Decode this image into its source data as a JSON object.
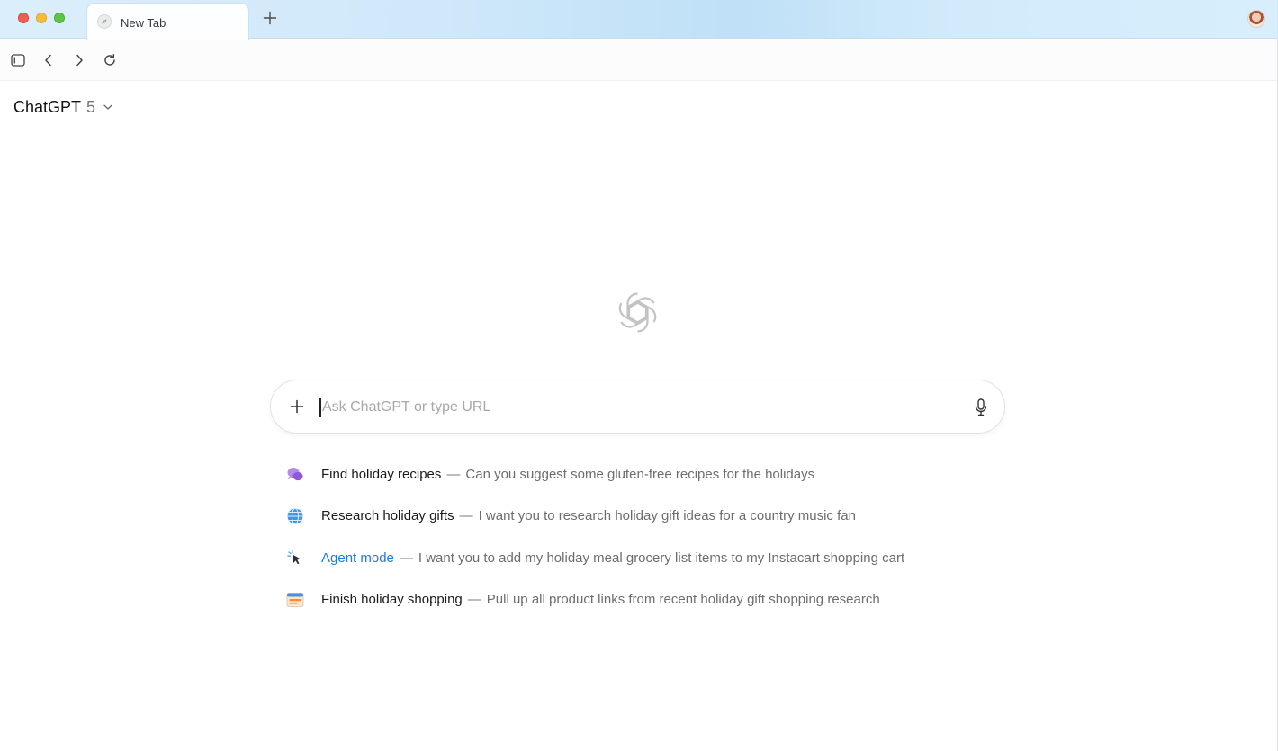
{
  "browser": {
    "tab": {
      "title": "New Tab",
      "icon": "compass-icon"
    },
    "new_tab_icon": "plus-icon",
    "profile_icon": "avatar"
  },
  "toolbar": {
    "sidebar_icon": "sidebar-toggle-icon",
    "back_icon": "chevron-left-icon",
    "forward_icon": "chevron-right-icon",
    "reload_icon": "reload-icon"
  },
  "model_selector": {
    "name": "ChatGPT",
    "version": "5",
    "icon": "chevron-down-icon"
  },
  "composer": {
    "placeholder": "Ask ChatGPT or type URL",
    "value": "",
    "attach_icon": "plus-icon",
    "mic_icon": "microphone-icon"
  },
  "suggestions": [
    {
      "title": "Find holiday recipes",
      "separator": "—",
      "description": "Can you suggest some gluten-free recipes for the holidays",
      "icon": "chat-bubbles-icon"
    },
    {
      "title": "Research holiday gifts",
      "separator": "—",
      "description": "I want you to research holiday gift ideas for a country music fan",
      "icon": "globe-icon"
    },
    {
      "title": "Agent mode",
      "separator": "—",
      "description": "I want you to add my holiday meal grocery list items to my Instacart shopping cart",
      "icon": "cursor-click-icon"
    },
    {
      "title": "Finish holiday shopping",
      "separator": "—",
      "description": "Pull up all product links from recent holiday gift shopping research",
      "icon": "browser-window-icon"
    }
  ],
  "colors": {
    "accent": "#1f7ae0",
    "traffic_red": "#ee5e56",
    "traffic_yellow": "#f5bd3c",
    "traffic_green": "#5ec54a",
    "titlebar": "#cfe8fa"
  }
}
